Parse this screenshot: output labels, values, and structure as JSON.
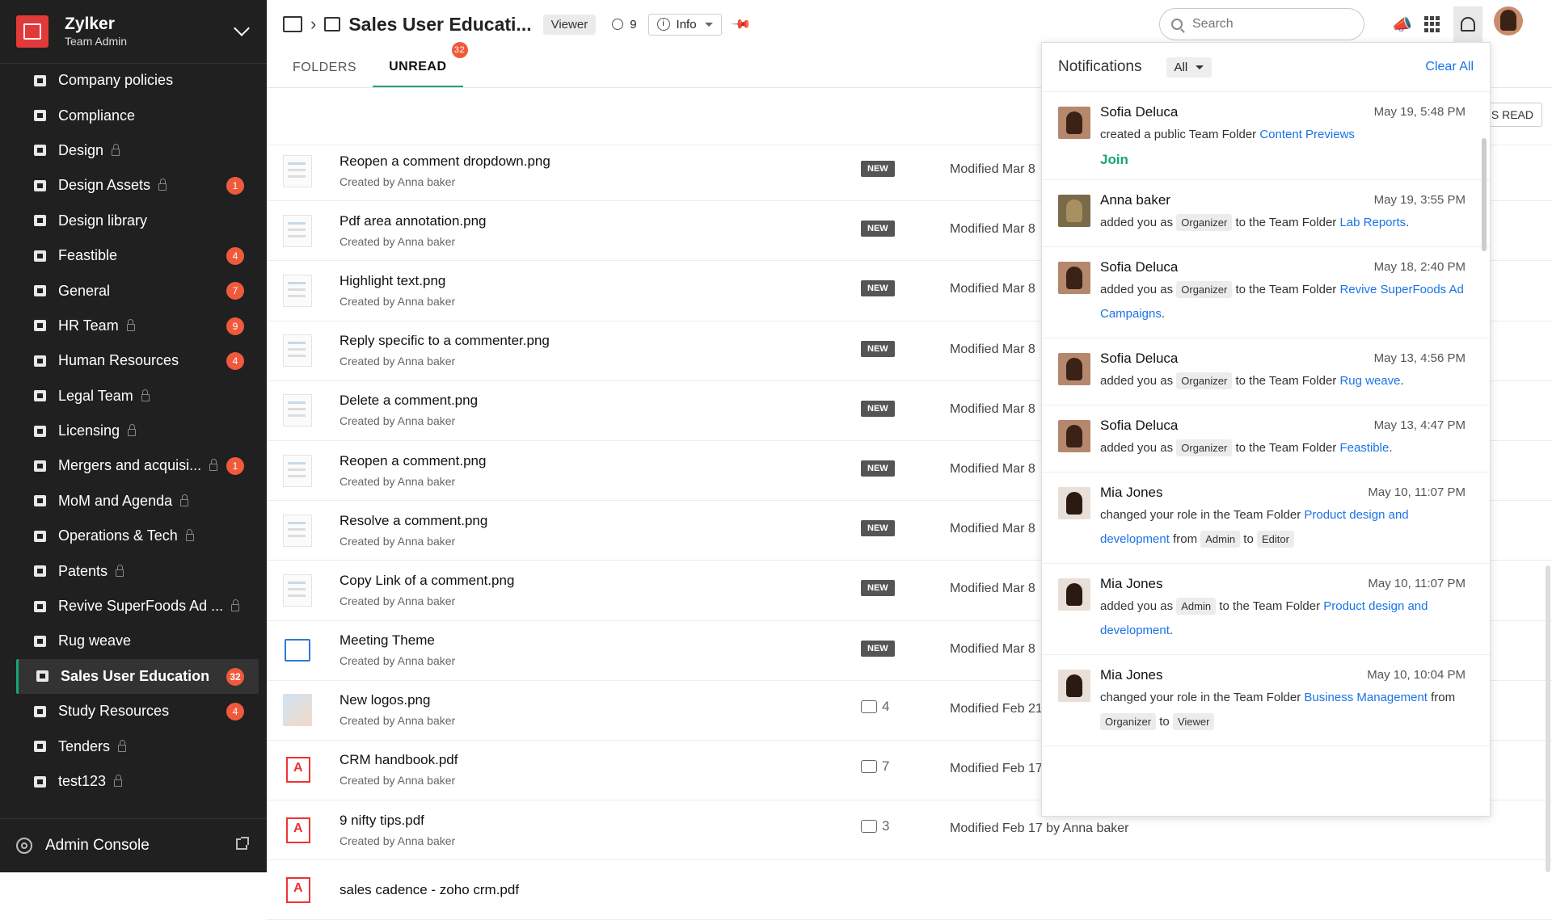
{
  "org": {
    "name": "Zylker",
    "role": "Team Admin"
  },
  "sidebar": {
    "items": [
      {
        "label": "Company policies",
        "lock": false,
        "badge": ""
      },
      {
        "label": "Compliance",
        "lock": false,
        "badge": ""
      },
      {
        "label": "Design",
        "lock": true,
        "badge": ""
      },
      {
        "label": "Design Assets",
        "lock": true,
        "badge": "1"
      },
      {
        "label": "Design library",
        "lock": false,
        "badge": ""
      },
      {
        "label": "Feastible",
        "lock": false,
        "badge": "4"
      },
      {
        "label": "General",
        "lock": false,
        "badge": "7"
      },
      {
        "label": "HR Team",
        "lock": true,
        "badge": "9"
      },
      {
        "label": "Human Resources",
        "lock": false,
        "badge": "4"
      },
      {
        "label": "Legal Team",
        "lock": true,
        "badge": ""
      },
      {
        "label": "Licensing",
        "lock": true,
        "badge": ""
      },
      {
        "label": "Mergers and acquisi...",
        "lock": true,
        "badge": "1"
      },
      {
        "label": "MoM and Agenda",
        "lock": true,
        "badge": ""
      },
      {
        "label": "Operations & Tech",
        "lock": true,
        "badge": ""
      },
      {
        "label": "Patents",
        "lock": true,
        "badge": ""
      },
      {
        "label": "Revive SuperFoods Ad ...",
        "lock": true,
        "badge": ""
      },
      {
        "label": "Rug weave",
        "lock": false,
        "badge": ""
      },
      {
        "label": "Sales User Education",
        "lock": false,
        "badge": "32",
        "active": true
      },
      {
        "label": "Study Resources",
        "lock": false,
        "badge": "4"
      },
      {
        "label": "Tenders",
        "lock": true,
        "badge": ""
      },
      {
        "label": "test123",
        "lock": true,
        "badge": ""
      }
    ],
    "admin_label": "Admin Console"
  },
  "header": {
    "title": "Sales User Educati...",
    "role": "Viewer",
    "members": "9",
    "info": "Info",
    "search_placeholder": "Search"
  },
  "tabs": {
    "folders": "FOLDERS",
    "unread": "UNREAD",
    "unread_count": "32"
  },
  "mark_read": "S READ",
  "files": [
    {
      "name": "Reopen a comment dropdown.png",
      "sub": "Created by Anna baker",
      "tag": "NEW",
      "comments": "",
      "modified": "Modified Mar 8",
      "thumb": "img"
    },
    {
      "name": "Pdf area annotation.png",
      "sub": "Created by Anna baker",
      "tag": "NEW",
      "comments": "",
      "modified": "Modified Mar 8",
      "thumb": "img"
    },
    {
      "name": "Highlight text.png",
      "sub": "Created by Anna baker",
      "tag": "NEW",
      "comments": "",
      "modified": "Modified Mar 8",
      "thumb": "img"
    },
    {
      "name": "Reply specific to a commenter.png",
      "sub": "Created by Anna baker",
      "tag": "NEW",
      "comments": "",
      "modified": "Modified Mar 8",
      "thumb": "img"
    },
    {
      "name": "Delete a comment.png",
      "sub": "Created by Anna baker",
      "tag": "NEW",
      "comments": "",
      "modified": "Modified Mar 8",
      "thumb": "img"
    },
    {
      "name": "Reopen a comment.png",
      "sub": "Created by Anna baker",
      "tag": "NEW",
      "comments": "",
      "modified": "Modified Mar 8",
      "thumb": "img"
    },
    {
      "name": "Resolve a comment.png",
      "sub": "Created by Anna baker",
      "tag": "NEW",
      "comments": "",
      "modified": "Modified Mar 8",
      "thumb": "img"
    },
    {
      "name": "Copy Link of a comment.png",
      "sub": "Created by Anna baker",
      "tag": "NEW",
      "comments": "",
      "modified": "Modified Mar 8",
      "thumb": "img"
    },
    {
      "name": "Meeting Theme",
      "sub": "Created by Anna baker",
      "tag": "NEW",
      "comments": "",
      "modified": "Modified Mar 8",
      "thumb": "meet"
    },
    {
      "name": "New logos.png",
      "sub": "Created by Anna baker",
      "tag": "",
      "comments": "4",
      "modified": "Modified Feb 21",
      "thumb": "logo-th"
    },
    {
      "name": "CRM handbook.pdf",
      "sub": "Created by Anna baker",
      "tag": "",
      "comments": "7",
      "modified": "Modified Feb 17",
      "thumb": "pdf"
    },
    {
      "name": "9 nifty tips.pdf",
      "sub": "Created by Anna baker",
      "tag": "",
      "comments": "3",
      "modified": "Modified Feb 17 by Anna baker",
      "thumb": "pdf"
    },
    {
      "name": "sales cadence - zoho crm.pdf",
      "sub": "",
      "tag": "",
      "comments": "",
      "modified": "",
      "thumb": "pdf"
    }
  ],
  "notifications": {
    "title": "Notifications",
    "filter": "All",
    "clear": "Clear All",
    "join": "Join",
    "items": [
      {
        "name": "Sofia Deluca",
        "time": "May 19, 5:48 PM",
        "av": "sofia",
        "parts": [
          {
            "t": "created a public Team Folder "
          },
          {
            "l": "Content Previews"
          }
        ],
        "join": true
      },
      {
        "name": "Anna baker",
        "time": "May 19, 3:55 PM",
        "av": "anna",
        "parts": [
          {
            "t": "added you as "
          },
          {
            "c": "Organizer"
          },
          {
            "t": " to the Team Folder "
          },
          {
            "l": "Lab Reports"
          },
          {
            "t": "."
          }
        ]
      },
      {
        "name": "Sofia Deluca",
        "time": "May 18, 2:40 PM",
        "av": "sofia",
        "parts": [
          {
            "t": "added you as "
          },
          {
            "c": "Organizer"
          },
          {
            "t": " to the Team Folder "
          },
          {
            "l": "Revive SuperFoods Ad Campaigns"
          },
          {
            "t": "."
          }
        ]
      },
      {
        "name": "Sofia Deluca",
        "time": "May 13, 4:56 PM",
        "av": "sofia",
        "parts": [
          {
            "t": "added you as "
          },
          {
            "c": "Organizer"
          },
          {
            "t": " to the Team Folder "
          },
          {
            "l": "Rug weave"
          },
          {
            "t": "."
          }
        ]
      },
      {
        "name": "Sofia Deluca",
        "time": "May 13, 4:47 PM",
        "av": "sofia",
        "parts": [
          {
            "t": "added you as "
          },
          {
            "c": "Organizer"
          },
          {
            "t": " to the Team Folder "
          },
          {
            "l": "Feastible"
          },
          {
            "t": "."
          }
        ]
      },
      {
        "name": "Mia Jones",
        "time": "May 10, 11:07 PM",
        "av": "mia",
        "parts": [
          {
            "t": "changed your role in the Team Folder "
          },
          {
            "l": "Product design and development"
          },
          {
            "t": " from "
          },
          {
            "c": "Admin"
          },
          {
            "t": " to "
          },
          {
            "c": "Editor"
          }
        ]
      },
      {
        "name": "Mia Jones",
        "time": "May 10, 11:07 PM",
        "av": "mia",
        "parts": [
          {
            "t": "added you as "
          },
          {
            "c": "Admin"
          },
          {
            "t": " to the Team Folder "
          },
          {
            "l": "Product design and development"
          },
          {
            "t": "."
          }
        ]
      },
      {
        "name": "Mia Jones",
        "time": "May 10, 10:04 PM",
        "av": "mia",
        "parts": [
          {
            "t": "changed your role in the Team Folder "
          },
          {
            "l": "Business Management"
          },
          {
            "t": " from "
          },
          {
            "c": "Organizer"
          },
          {
            "t": " to "
          },
          {
            "c": "Viewer"
          }
        ]
      }
    ]
  }
}
